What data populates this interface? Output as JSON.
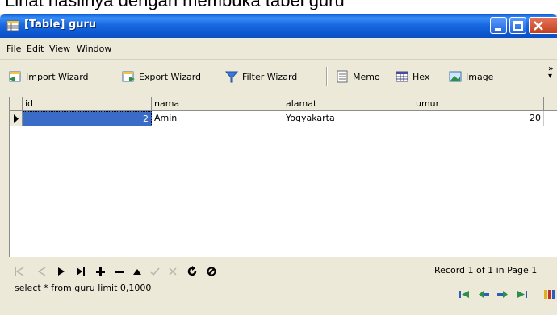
{
  "caption": "Lihat hasilnya dengan membuka tabel guru",
  "window": {
    "title": "[Table] guru"
  },
  "menu": [
    "File",
    "Edit",
    "View",
    "Window"
  ],
  "toolbar": {
    "import_wizard": "Import Wizard",
    "export_wizard": "Export Wizard",
    "filter_wizard": "Filter Wizard",
    "memo": "Memo",
    "hex": "Hex",
    "image": "Image"
  },
  "grid": {
    "columns": [
      "id",
      "nama",
      "alamat",
      "umur"
    ],
    "rows": [
      {
        "id": "2",
        "nama": "Amin",
        "alamat": "Yogyakarta",
        "umur": "20"
      }
    ]
  },
  "status": {
    "record_info": "Record 1 of 1 in Page 1",
    "sql": "select * from guru limit 0,1000"
  },
  "colors": {
    "titlebar": "#0a5fd8",
    "window_bg": "#ece9d8",
    "selection": "#3a6bc7",
    "nav_green": "#2f8f4a",
    "nav_blue": "#2c5fb8"
  }
}
